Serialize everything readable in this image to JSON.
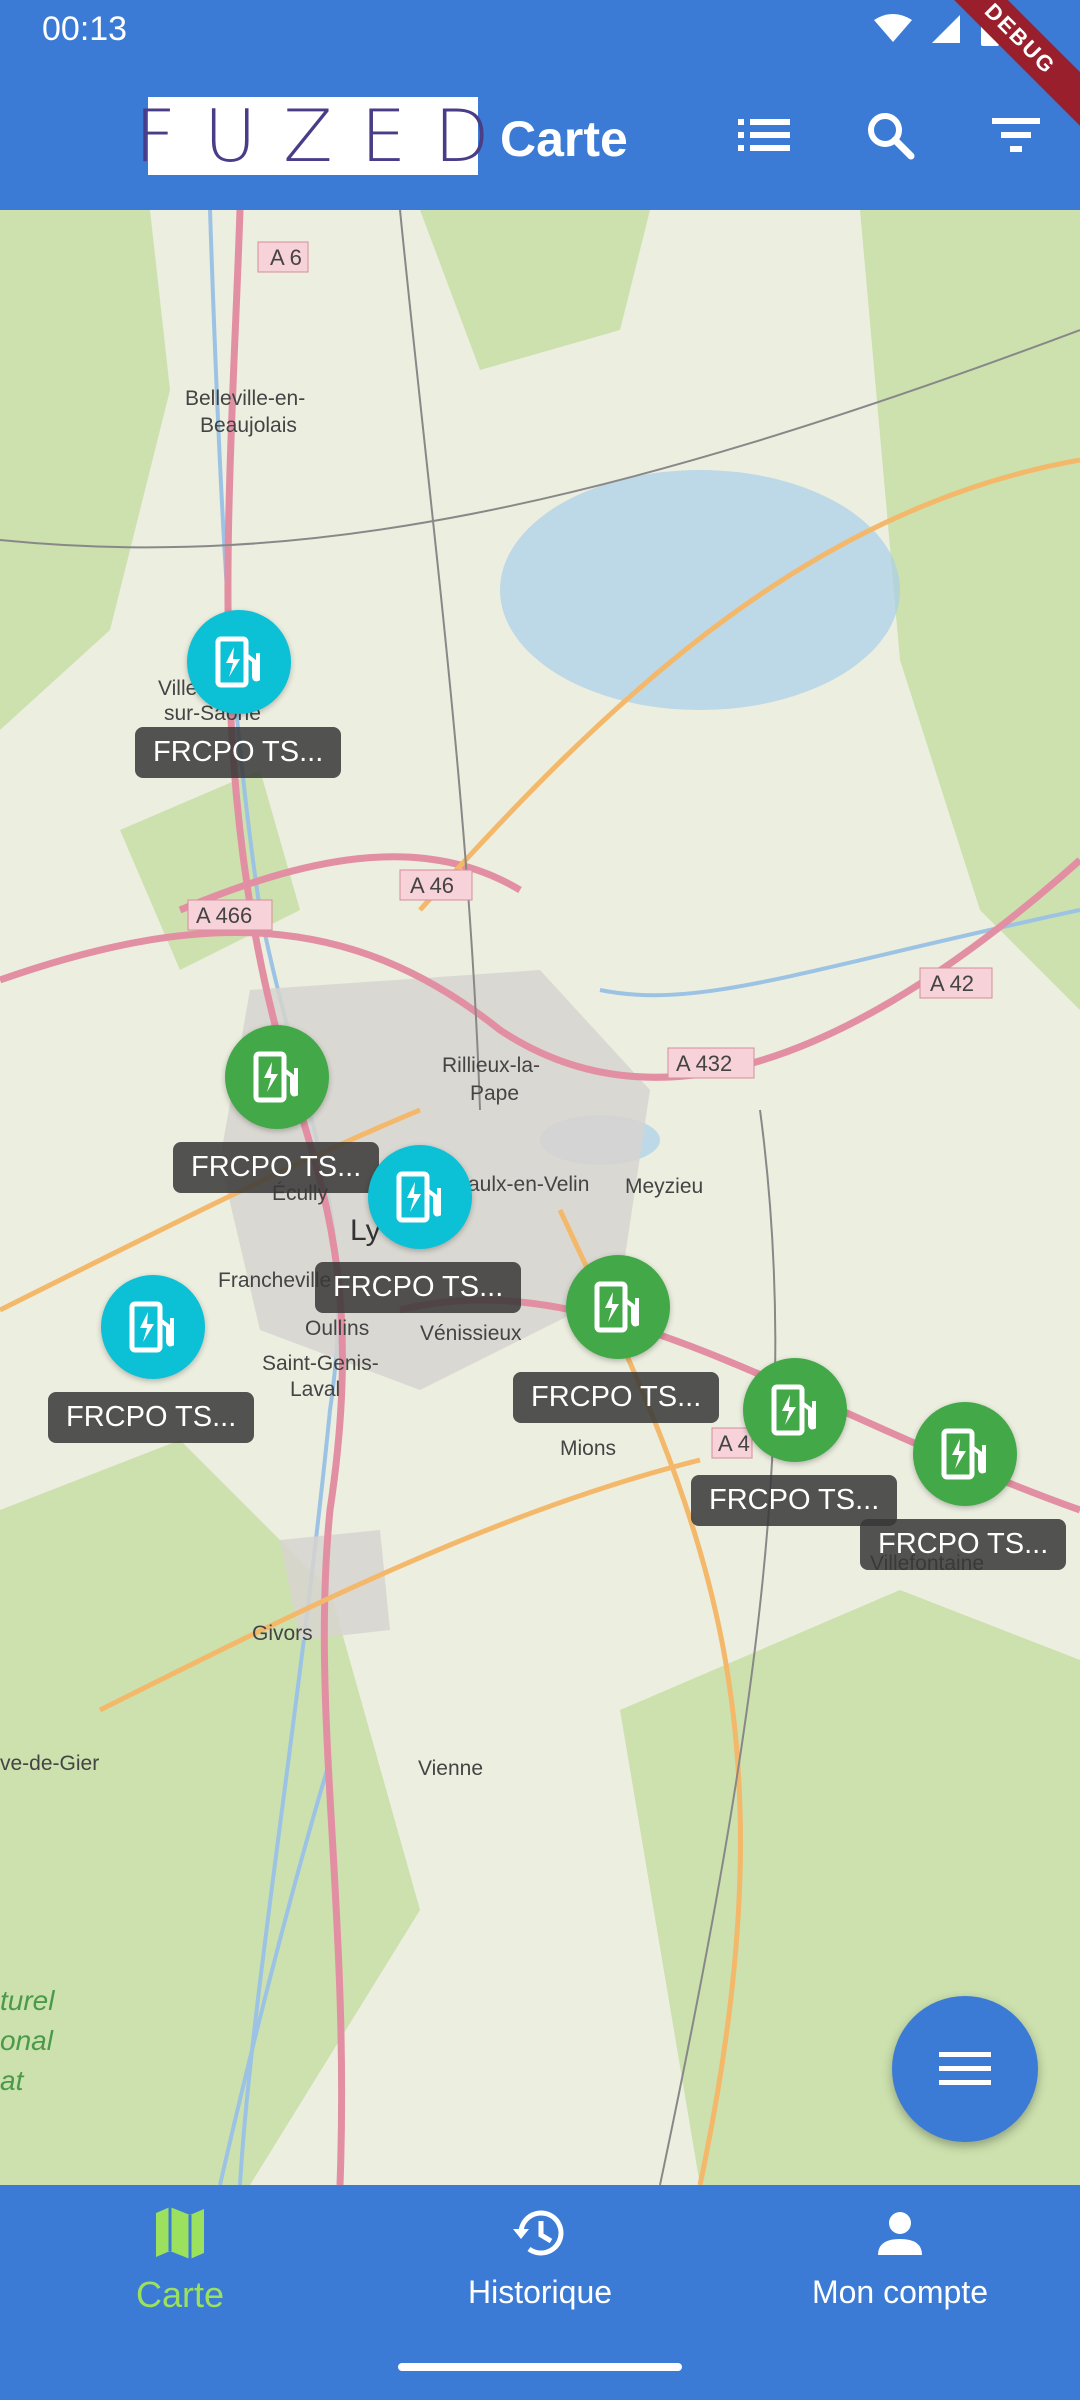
{
  "status": {
    "time": "00:13"
  },
  "debug_banner": "DEBUG",
  "appbar": {
    "logo_text": "FUZED",
    "title": "Carte"
  },
  "map_labels": {
    "places": [
      "Belleville-en-Beaujolais",
      "Villefranche-sur-Saône",
      "Rillieux-la-Pape",
      "Vaulx-en-Velin",
      "Meyzieu",
      "Écully",
      "Francheville",
      "Oullins",
      "Saint-Genis-Laval",
      "Vénissieux",
      "Mions",
      "Villefontaine",
      "Givors",
      "Vienne",
      "Rive-de-Gier",
      "Lyon"
    ],
    "roads": [
      "A 6",
      "A 46",
      "A 466",
      "A 432",
      "A 42",
      "A 4"
    ]
  },
  "stations": [
    {
      "label": "FRCPO TS...",
      "color": "cyan"
    },
    {
      "label": "FRCPO TS...",
      "color": "green"
    },
    {
      "label": "FRCPO TS...",
      "color": "cyan"
    },
    {
      "label": "FRCPO TS...",
      "color": "cyan"
    },
    {
      "label": "FRCPO TS...",
      "color": "green"
    },
    {
      "label": "FRCPO TS...",
      "color": "green"
    },
    {
      "label": "FRCPO TS...",
      "color": "green"
    }
  ],
  "nav": [
    {
      "label": "Carte",
      "icon": "map-icon",
      "active": true
    },
    {
      "label": "Historique",
      "icon": "history-icon",
      "active": false
    },
    {
      "label": "Mon compte",
      "icon": "person-icon",
      "active": false
    }
  ],
  "colors": {
    "primary": "#3b7bd6",
    "active_nav": "#9be15d",
    "pin_cyan": "#0cc0d6",
    "pin_green": "#43a948"
  }
}
